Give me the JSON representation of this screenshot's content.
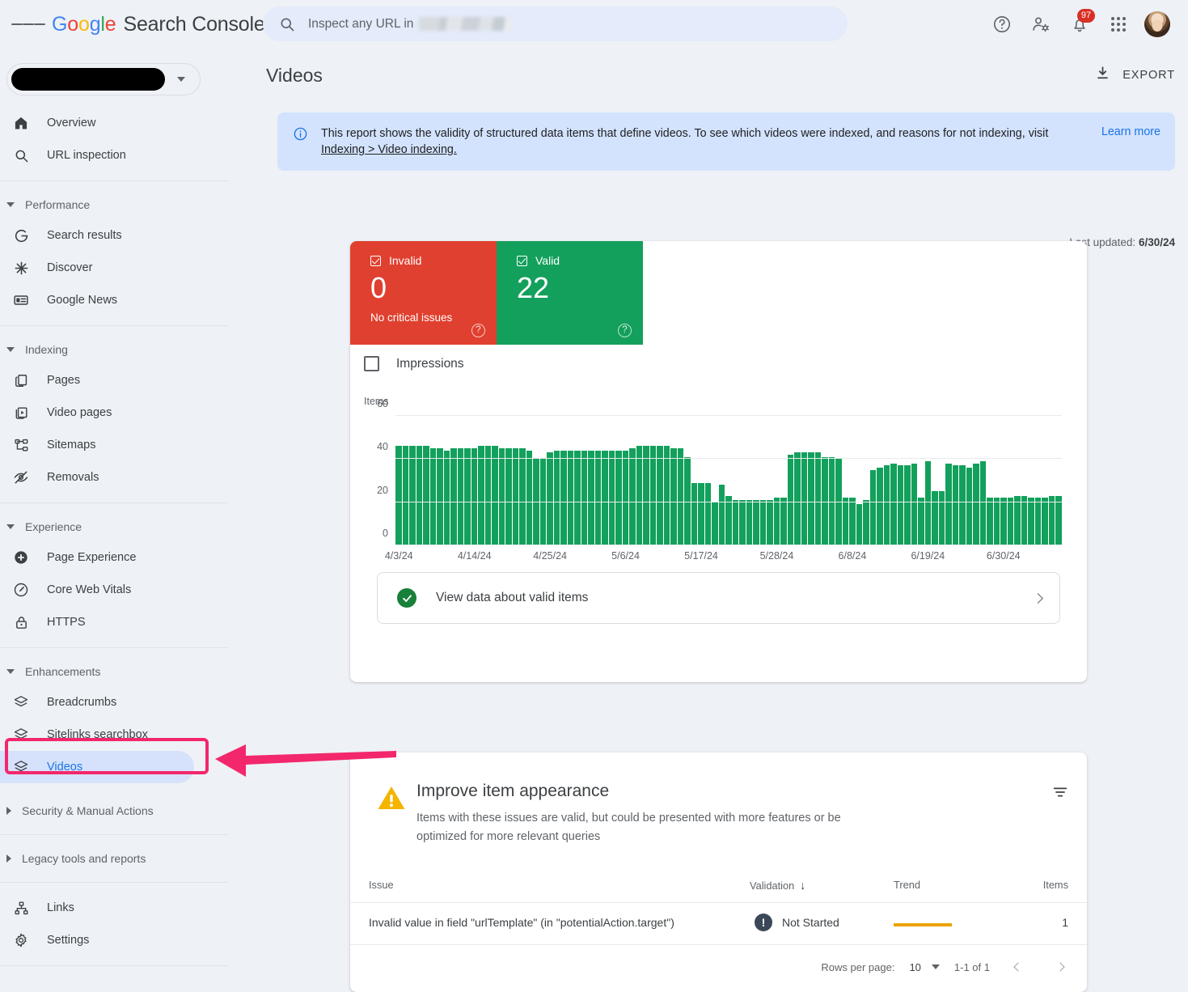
{
  "header": {
    "menu_icon": "hamburger-icon",
    "brand": {
      "g": "G",
      "o1": "o",
      "o2": "o",
      "g2": "g",
      "l": "l",
      "e": "e",
      "product": "Search Console"
    },
    "search": {
      "placeholder_prefix": "Inspect any URL in",
      "icon": "search-icon",
      "redacted": true
    },
    "icons": [
      {
        "name": "help-icon",
        "label": "?"
      },
      {
        "name": "user-settings-icon",
        "label": ""
      },
      {
        "name": "notifications-icon",
        "label": "",
        "badge": "97"
      },
      {
        "name": "google-apps-icon",
        "label": ""
      },
      {
        "name": "account-avatar",
        "label": ""
      }
    ],
    "notification_count": "97"
  },
  "sidebar": {
    "property_selector": {
      "value_redacted": true,
      "caret": "chevron-down-icon"
    },
    "items": [
      {
        "label": "Overview",
        "icon": "home-icon",
        "type": "item"
      },
      {
        "label": "URL inspection",
        "icon": "search-icon",
        "type": "item"
      },
      {
        "label": "Performance",
        "icon": "chevron-down-icon",
        "type": "group",
        "expanded": true
      },
      {
        "label": "Search results",
        "icon": "google-g-icon",
        "type": "item"
      },
      {
        "label": "Discover",
        "icon": "discover-asterisk-icon",
        "type": "item"
      },
      {
        "label": "Google News",
        "icon": "news-card-icon",
        "type": "item"
      },
      {
        "label": "Indexing",
        "icon": "chevron-down-icon",
        "type": "group",
        "expanded": true
      },
      {
        "label": "Pages",
        "icon": "pages-copy-icon",
        "type": "item"
      },
      {
        "label": "Video pages",
        "icon": "video-page-icon",
        "type": "item"
      },
      {
        "label": "Sitemaps",
        "icon": "sitemap-icon",
        "type": "item"
      },
      {
        "label": "Removals",
        "icon": "eye-off-icon",
        "type": "item"
      },
      {
        "label": "Experience",
        "icon": "chevron-down-icon",
        "type": "group",
        "expanded": true
      },
      {
        "label": "Page Experience",
        "icon": "page-experience-icon",
        "type": "item"
      },
      {
        "label": "Core Web Vitals",
        "icon": "speedometer-icon",
        "type": "item"
      },
      {
        "label": "HTTPS",
        "icon": "lock-icon",
        "type": "item"
      },
      {
        "label": "Enhancements",
        "icon": "chevron-down-icon",
        "type": "group",
        "expanded": true
      },
      {
        "label": "Breadcrumbs",
        "icon": "layers-icon",
        "type": "item"
      },
      {
        "label": "Sitelinks searchbox",
        "icon": "layers-icon",
        "type": "item"
      },
      {
        "label": "Videos",
        "icon": "layers-icon",
        "type": "item",
        "active": true
      },
      {
        "label": "Security & Manual Actions",
        "icon": "chevron-right-icon",
        "type": "group",
        "expanded": false
      },
      {
        "label": "Legacy tools and reports",
        "icon": "chevron-right-icon",
        "type": "group",
        "expanded": false
      },
      {
        "label": "Links",
        "icon": "links-icon",
        "type": "item"
      },
      {
        "label": "Settings",
        "icon": "gear-icon",
        "type": "item"
      }
    ],
    "highlight": {
      "target": "Videos",
      "box_color": "#f3276c",
      "arrow_color": "#f3276c"
    }
  },
  "main": {
    "page_title": "Videos",
    "export_label": "EXPORT",
    "export_icon": "download-icon",
    "info_banner": {
      "icon": "info-icon",
      "text_part1": "This report shows the validity of structured data items that define videos. To see which videos were indexed, and reasons for not indexing, visit ",
      "link_text": "Indexing > Video indexing.",
      "learn_more": "Learn more"
    },
    "last_updated_label": "Last updated:",
    "last_updated_value": "6/30/24",
    "status_cards": [
      {
        "label": "Invalid",
        "count": "0",
        "sub": "No critical issues",
        "color": "#e0402f",
        "checked": true,
        "help": "?"
      },
      {
        "label": "Valid",
        "count": "22",
        "sub": "",
        "color": "#13a05c",
        "checked": true,
        "help": "?"
      }
    ],
    "impressions_toggle": {
      "label": "Impressions",
      "checked": false
    },
    "valid_items_link": {
      "label": "View data about valid items",
      "icon": "check-circle-icon",
      "chevron": "chevron-right-icon"
    },
    "improve_section": {
      "icon": "warning-triangle-icon",
      "title": "Improve item appearance",
      "subtitle": "Items with these issues are valid, but could be presented with more features or be optimized for more relevant queries",
      "filter_icon": "filter-list-icon",
      "columns": [
        "Issue",
        "Validation",
        "Trend",
        "Items"
      ],
      "sort_column": "Validation",
      "sort_dir": "descending",
      "rows": [
        {
          "issue": "Invalid value in field \"urlTemplate\" (in \"potentialAction.target\")",
          "validation": "Not Started",
          "validation_icon": "exclamation-circle-icon",
          "trend_color": "#eba400",
          "items": "1"
        }
      ],
      "pagination": {
        "rows_per_page_label": "Rows per page:",
        "rows_per_page_value": "10",
        "range": "1-1 of 1",
        "prev_icon": "chevron-left-icon",
        "next_icon": "chevron-right-icon"
      }
    }
  },
  "chart_data": {
    "type": "bar",
    "title": "",
    "ylabel": "Items",
    "xlabel": "",
    "ylim": [
      0,
      60
    ],
    "yticks": [
      0,
      20,
      40,
      60
    ],
    "grid": true,
    "series_name": "Valid items",
    "series_color": "#13a05c",
    "tick_labels": [
      "4/3/24",
      "4/14/24",
      "4/25/24",
      "5/6/24",
      "5/17/24",
      "5/28/24",
      "6/8/24",
      "6/19/24",
      "6/30/24"
    ],
    "tick_indices": [
      0,
      11,
      22,
      33,
      44,
      55,
      66,
      77,
      88
    ],
    "values": [
      46,
      46,
      46,
      46,
      46,
      45,
      45,
      44,
      45,
      45,
      45,
      45,
      46,
      46,
      46,
      45,
      45,
      45,
      45,
      44,
      40,
      40,
      43,
      44,
      44,
      44,
      44,
      44,
      44,
      44,
      44,
      44,
      44,
      44,
      45,
      46,
      46,
      46,
      46,
      46,
      45,
      45,
      41,
      29,
      29,
      29,
      20,
      28,
      23,
      21,
      21,
      21,
      21,
      21,
      21,
      22,
      22,
      42,
      43,
      43,
      43,
      43,
      41,
      41,
      40,
      22,
      22,
      19,
      21,
      35,
      36,
      37,
      38,
      37,
      37,
      38,
      22,
      39,
      25,
      25,
      38,
      37,
      37,
      36,
      38,
      39,
      22,
      22,
      22,
      22,
      23,
      23,
      22,
      22,
      22,
      23,
      23
    ]
  }
}
